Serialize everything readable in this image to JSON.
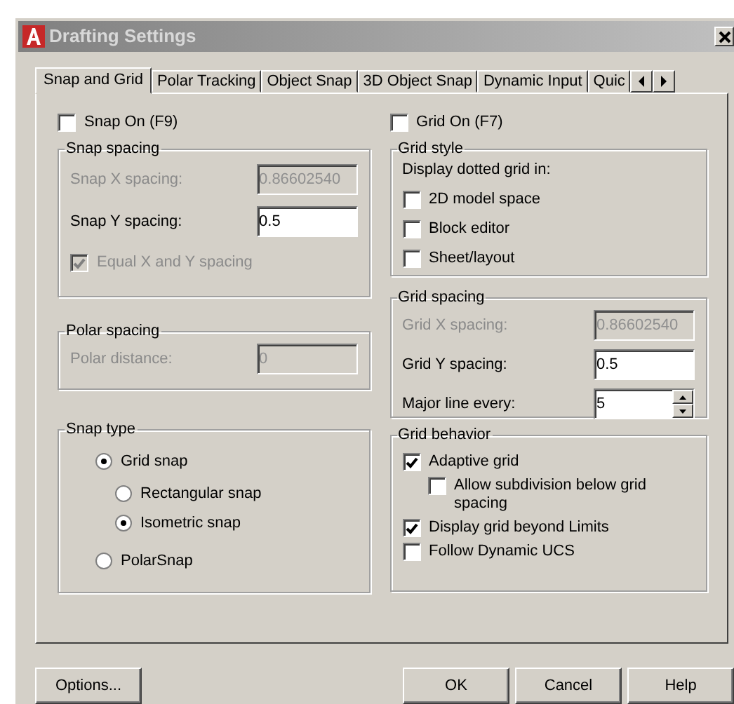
{
  "window": {
    "title": "Drafting Settings"
  },
  "tabs": [
    {
      "label": "Snap and Grid",
      "selected": true
    },
    {
      "label": "Polar Tracking",
      "selected": false
    },
    {
      "label": "Object Snap",
      "selected": false
    },
    {
      "label": "3D Object Snap",
      "selected": false
    },
    {
      "label": "Dynamic Input",
      "selected": false
    },
    {
      "label": "Quic",
      "selected": false
    }
  ],
  "snap_on": {
    "label": "Snap On (F9)",
    "checked": false
  },
  "snap_spacing": {
    "title": "Snap spacing",
    "fields": [
      {
        "label": "Snap X spacing:",
        "value": "0.86602540",
        "disabled": true
      },
      {
        "label": "Snap Y spacing:",
        "value": "0.5",
        "disabled": false
      }
    ],
    "equal": {
      "label": "Equal X and Y spacing",
      "checked": true,
      "disabled": true
    }
  },
  "polar_spacing": {
    "title": "Polar spacing",
    "fields": [
      {
        "label": "Polar distance:",
        "value": "0",
        "disabled": true
      }
    ]
  },
  "snap_type": {
    "title": "Snap type",
    "options": [
      {
        "label": "Grid snap",
        "selected": true,
        "children": [
          {
            "label": "Rectangular snap",
            "selected": false
          },
          {
            "label": "Isometric snap",
            "selected": true
          }
        ]
      },
      {
        "label": "PolarSnap",
        "selected": false
      }
    ]
  },
  "grid_on": {
    "label": "Grid On (F7)",
    "checked": false
  },
  "grid_style": {
    "title": "Grid style",
    "caption": "Display dotted grid in:",
    "options": [
      {
        "label": "2D model space",
        "checked": false
      },
      {
        "label": "Block editor",
        "checked": false
      },
      {
        "label": "Sheet/layout",
        "checked": false
      }
    ]
  },
  "grid_spacing": {
    "title": "Grid spacing",
    "fields": [
      {
        "label": "Grid X spacing:",
        "value": "0.86602540",
        "disabled": true,
        "kind": "text"
      },
      {
        "label": "Grid Y spacing:",
        "value": "0.5",
        "disabled": false,
        "kind": "text"
      },
      {
        "label": "Major line every:",
        "value": "5",
        "disabled": false,
        "kind": "spinner"
      }
    ]
  },
  "grid_behavior": {
    "title": "Grid behavior",
    "options": [
      {
        "label": "Adaptive grid",
        "checked": true,
        "children": [
          {
            "label": "Allow subdivision below grid spacing",
            "checked": false
          }
        ]
      },
      {
        "label": "Display grid beyond Limits",
        "checked": true
      },
      {
        "label": "Follow Dynamic UCS",
        "checked": false
      }
    ]
  },
  "buttons": [
    {
      "label": "Options..."
    },
    {
      "label": "OK"
    },
    {
      "label": "Cancel"
    },
    {
      "label": "Help"
    }
  ]
}
